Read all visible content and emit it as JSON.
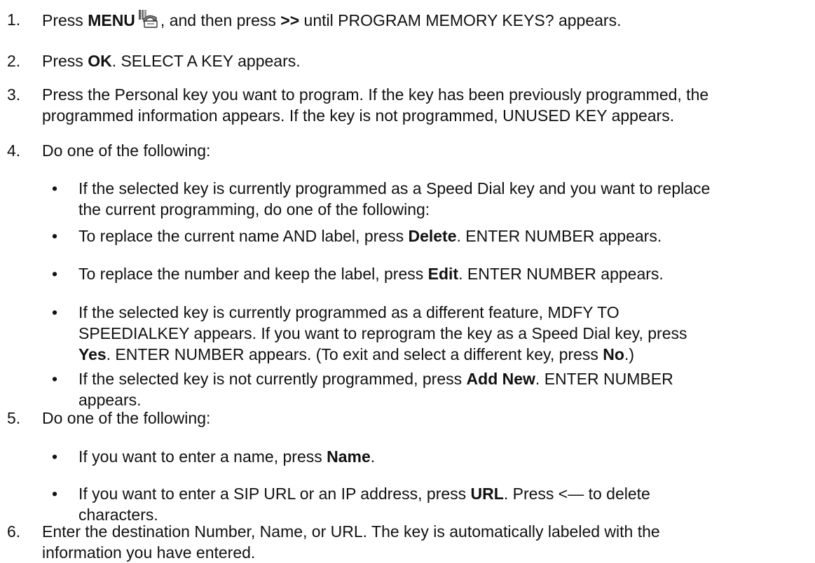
{
  "steps": [
    {
      "num": "1.",
      "a": "Press ",
      "b1": "MENU",
      "c": ", and then press ",
      "b2": ">>",
      "d": " until PROGRAM MEMORY KEYS? appears.",
      "icon": "phone-menu-icon"
    },
    {
      "num": "2.",
      "a": "Press ",
      "b1": "OK",
      "c": ". SELECT A KEY appears."
    },
    {
      "num": "3.",
      "line1": "Press the Personal key you want to program. If the key has been previously programmed, the",
      "line2": "programmed information appears. If the key is not programmed, UNUSED KEY appears."
    },
    {
      "num": "4.",
      "text": "Do one of the following:"
    },
    {
      "num": "5.",
      "text": "Do one of the following:"
    },
    {
      "num": "6.",
      "line1": "Enter the destination Number, Name, or URL. The key is automatically labeled with the",
      "line2": "information you have entered."
    }
  ],
  "step4_bullets": [
    {
      "dot": "•",
      "line1": "If the selected key is currently programmed as a Speed Dial key and you want to replace",
      "line2": "the current programming, do one of the following:"
    },
    {
      "dot": "•",
      "a": "To replace the current name AND label, press ",
      "b": "Delete",
      "c": ". ENTER NUMBER appears."
    },
    {
      "dot": "•",
      "a": "To replace the number and keep the label, press ",
      "b": "Edit",
      "c": ". ENTER NUMBER appears."
    },
    {
      "dot": "•",
      "line1": "If the selected key is currently programmed as a different feature, MDFY TO",
      "line2": "SPEEDIALKEY appears. If you want to reprogram the key as a Speed Dial key, press",
      "l3b1": "Yes",
      "l3a": ". ENTER NUMBER appears. (To exit and select a different key, press ",
      "l3b2": "No",
      "l3c": ".)"
    },
    {
      "dot": "•",
      "l1a": "If the selected key is not currently programmed, press ",
      "l1b": "Add New",
      "l1c": ". ENTER NUMBER",
      "line2": "appears."
    }
  ],
  "step5_bullets": [
    {
      "dot": "•",
      "a": "If you want to enter a name, press ",
      "b": "Name",
      "c": "."
    },
    {
      "dot": "•",
      "l1a": "If you want to enter a SIP URL or an IP address, press ",
      "l1b": "URL",
      "l1c": ".  Press <— to delete",
      "line2": "characters."
    }
  ]
}
